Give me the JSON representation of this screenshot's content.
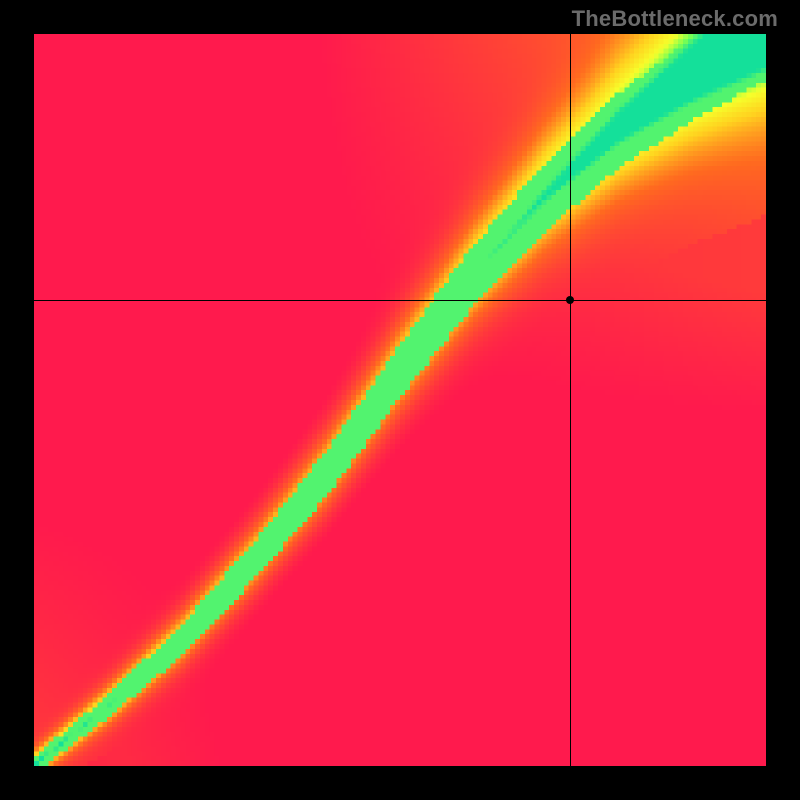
{
  "watermark": "TheBottleneck.com",
  "chart_data": {
    "type": "heatmap",
    "title": "",
    "xlabel": "",
    "ylabel": "",
    "xlim": [
      0,
      1
    ],
    "ylim": [
      0,
      1
    ],
    "grid": false,
    "legend": false,
    "marker": {
      "x": 0.733,
      "y": 0.636
    },
    "crosshair": {
      "x": 0.733,
      "y": 0.636
    },
    "ridge_points": [
      {
        "x": 0.0,
        "y": 0.0
      },
      {
        "x": 0.1,
        "y": 0.08
      },
      {
        "x": 0.2,
        "y": 0.17
      },
      {
        "x": 0.3,
        "y": 0.28
      },
      {
        "x": 0.4,
        "y": 0.4
      },
      {
        "x": 0.5,
        "y": 0.54
      },
      {
        "x": 0.6,
        "y": 0.67
      },
      {
        "x": 0.7,
        "y": 0.78
      },
      {
        "x": 0.8,
        "y": 0.87
      },
      {
        "x": 0.9,
        "y": 0.94
      },
      {
        "x": 1.0,
        "y": 1.0
      }
    ],
    "colorscale": [
      {
        "t": 0.0,
        "color": "#ff1a4d"
      },
      {
        "t": 0.35,
        "color": "#ff6a1f"
      },
      {
        "t": 0.6,
        "color": "#ffd21f"
      },
      {
        "t": 0.78,
        "color": "#f6ff2b"
      },
      {
        "t": 0.9,
        "color": "#7bff52"
      },
      {
        "t": 1.0,
        "color": "#14e09a"
      }
    ],
    "resolution": 150
  }
}
